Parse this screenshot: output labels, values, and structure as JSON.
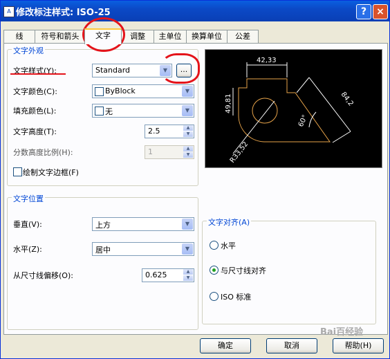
{
  "title": "修改标注样式: ISO-25",
  "tabs": [
    {
      "label": "线"
    },
    {
      "label": "符号和箭头"
    },
    {
      "label": "文字"
    },
    {
      "label": "调整"
    },
    {
      "label": "主单位"
    },
    {
      "label": "换算单位"
    },
    {
      "label": "公差"
    }
  ],
  "text_appearance": {
    "title": "文字外观",
    "style_label": "文字样式(Y):",
    "style_value": "Standard",
    "browse_label": "...",
    "color_label": "文字颜色(C):",
    "color_value": "ByBlock",
    "fill_label": "填充颜色(L):",
    "fill_value": "无",
    "height_label": "文字高度(T):",
    "height_value": "2.5",
    "fraction_label": "分数高度比例(H):",
    "fraction_value": "1",
    "frame_label": "绘制文字边框(F)",
    "frame_checked": false
  },
  "preview": {
    "dim_top": "42,33",
    "dim_left": "49,81",
    "dim_right": "84,2",
    "dim_angle": "60°",
    "dim_radius": "R33,52",
    "line_color": "#e8a44a",
    "dim_color": "#ffffff"
  },
  "text_placement": {
    "title": "文字位置",
    "vertical_label": "垂直(V):",
    "vertical_value": "上方",
    "horizontal_label": "水平(Z):",
    "horizontal_value": "居中",
    "offset_label": "从尺寸线偏移(O):",
    "offset_value": "0.625"
  },
  "text_alignment": {
    "title": "文字对齐(A)",
    "options": [
      {
        "label": "水平",
        "selected": false
      },
      {
        "label": "与尺寸线对齐",
        "selected": true
      },
      {
        "label": "ISO 标准",
        "selected": false
      }
    ]
  },
  "buttons": {
    "ok": "确定",
    "cancel": "取消",
    "help": "帮助(H)"
  },
  "title_buttons": {
    "help": "?",
    "close": "×"
  },
  "watermark": "Bai百经验",
  "annotation_color": "#e4131a"
}
